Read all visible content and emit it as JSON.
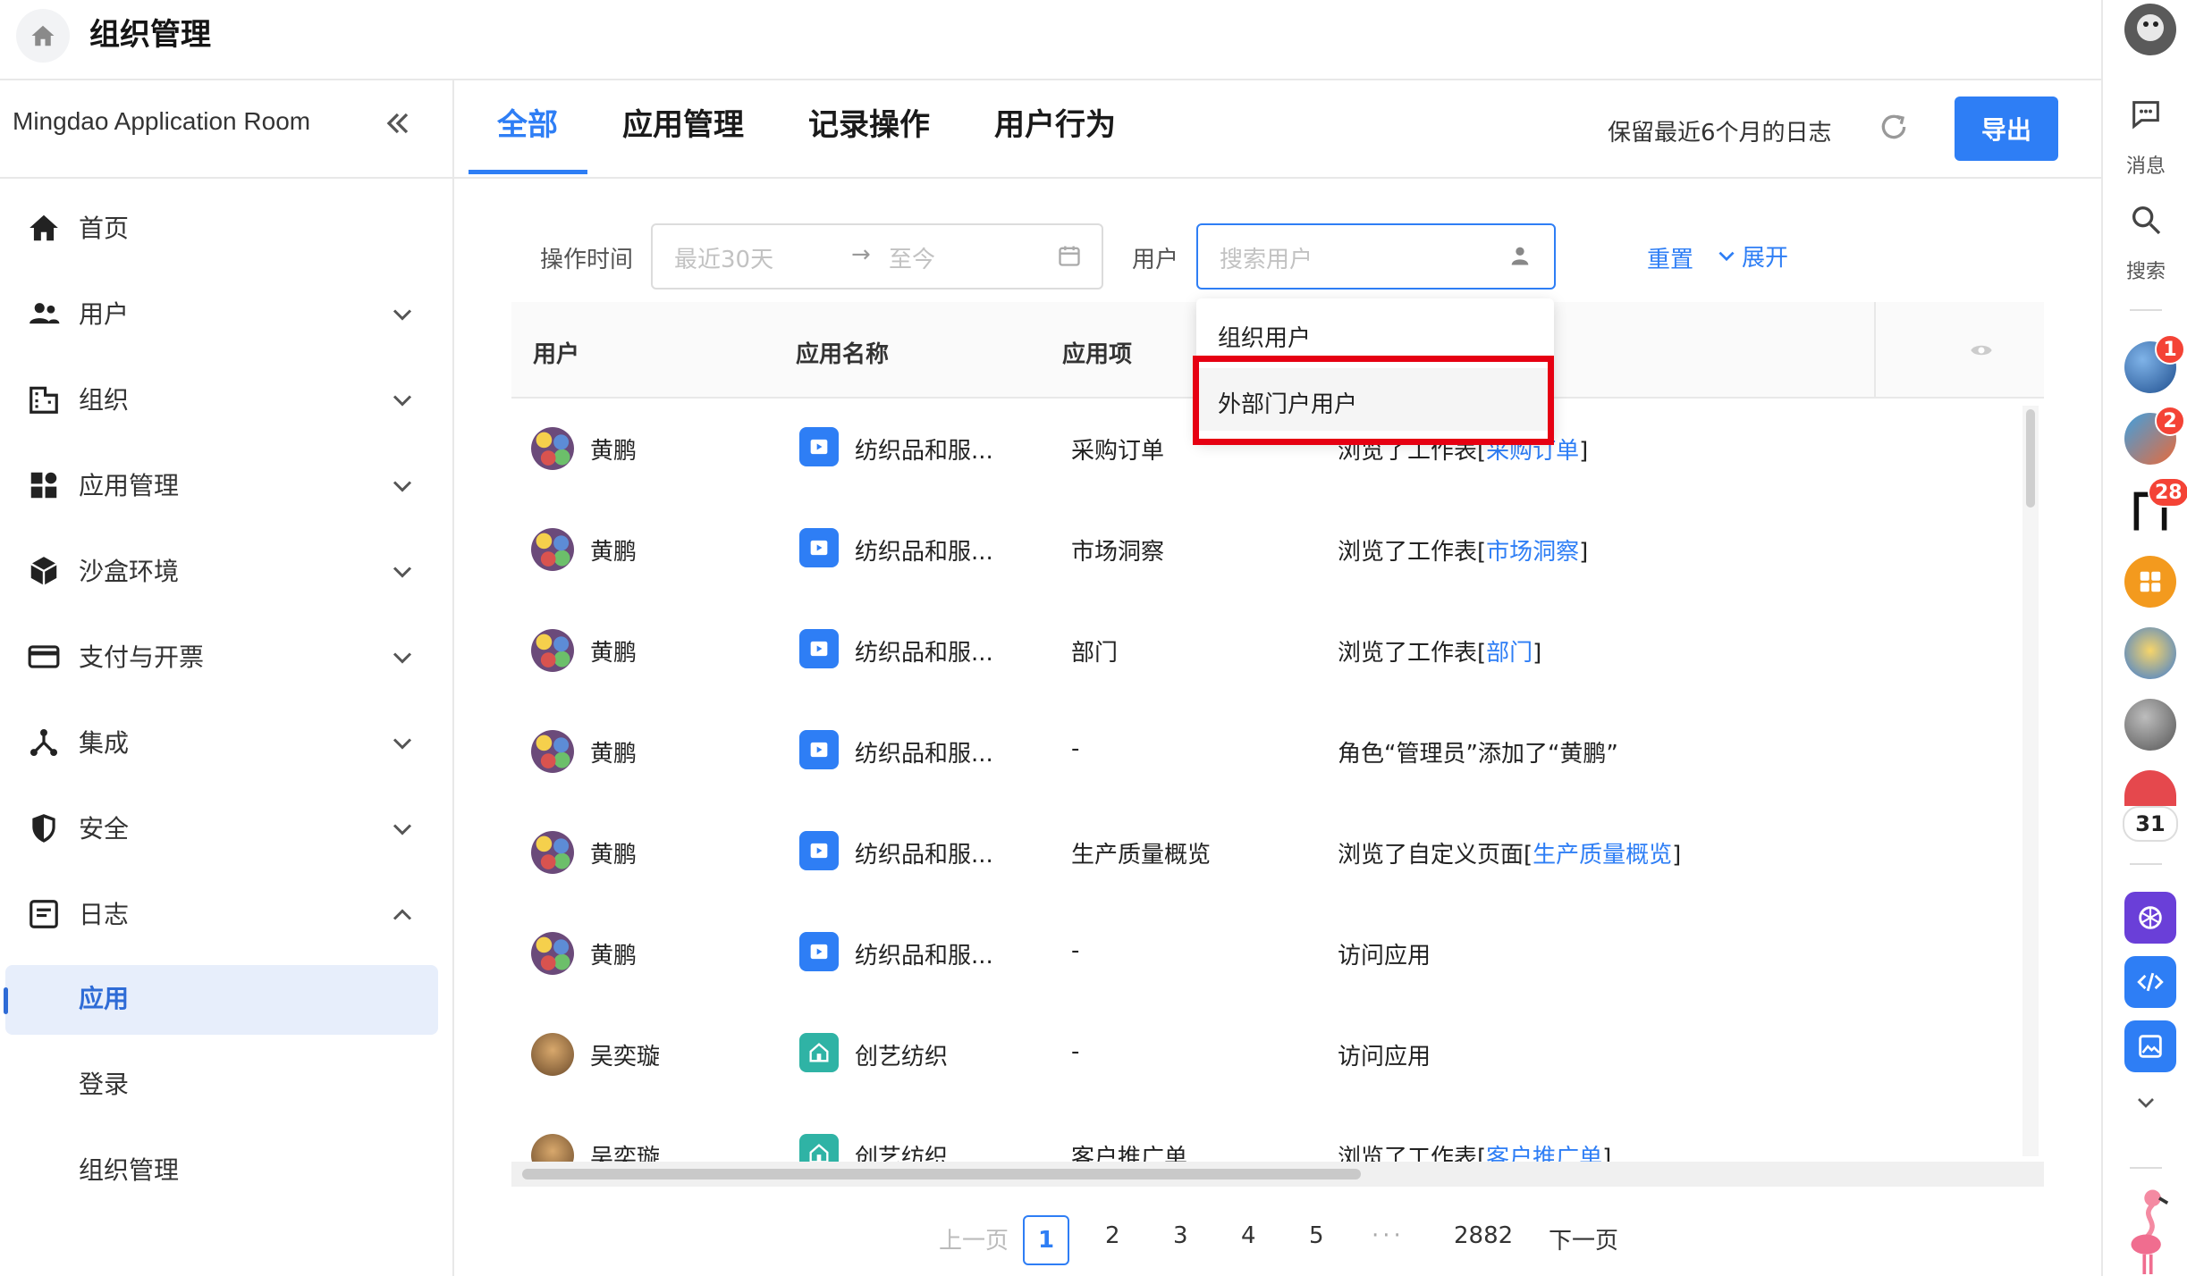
{
  "header": {
    "title": "组织管理"
  },
  "sidebar": {
    "workspace": "Mingdao Application Room",
    "items": [
      {
        "label": "首页"
      },
      {
        "label": "用户"
      },
      {
        "label": "组织"
      },
      {
        "label": "应用管理"
      },
      {
        "label": "沙盒环境"
      },
      {
        "label": "支付与开票"
      },
      {
        "label": "集成"
      },
      {
        "label": "安全"
      },
      {
        "label": "日志"
      }
    ],
    "log_subitems": [
      {
        "label": "应用"
      },
      {
        "label": "登录"
      },
      {
        "label": "组织管理"
      }
    ]
  },
  "tabs": [
    {
      "label": "全部"
    },
    {
      "label": "应用管理"
    },
    {
      "label": "记录操作"
    },
    {
      "label": "用户行为"
    }
  ],
  "toolbar": {
    "retention": "保留最近6个月的日志",
    "export_label": "导出"
  },
  "filters": {
    "time_label": "操作时间",
    "time_start_placeholder": "最近30天",
    "arrow": "→",
    "time_end_placeholder": "至今",
    "user_label": "用户",
    "user_placeholder": "搜索用户",
    "reset": "重置",
    "expand": "展开"
  },
  "dropdown": {
    "options": [
      {
        "label": "组织用户"
      },
      {
        "label": "外部门户用户"
      }
    ]
  },
  "table": {
    "columns": [
      "用户",
      "应用名称",
      "应用项"
    ],
    "rows": [
      {
        "user": "黄鹏",
        "app": "纺织品和服...",
        "item": "采购订单",
        "action_prefix": "浏览了工作表[",
        "action_link": "采购订单",
        "action_suffix": "]"
      },
      {
        "user": "黄鹏",
        "app": "纺织品和服...",
        "item": "市场洞察",
        "action_prefix": "浏览了工作表[",
        "action_link": "市场洞察",
        "action_suffix": "]"
      },
      {
        "user": "黄鹏",
        "app": "纺织品和服...",
        "item": "部门",
        "action_prefix": "浏览了工作表[",
        "action_link": "部门",
        "action_suffix": "]"
      },
      {
        "user": "黄鹏",
        "app": "纺织品和服...",
        "item": "-",
        "action_prefix": "角色“管理员”添加了“黄鹏”",
        "action_link": "",
        "action_suffix": ""
      },
      {
        "user": "黄鹏",
        "app": "纺织品和服...",
        "item": "生产质量概览",
        "action_prefix": "浏览了自定义页面[",
        "action_link": "生产质量概览",
        "action_suffix": "]"
      },
      {
        "user": "黄鹏",
        "app": "纺织品和服...",
        "item": "-",
        "action_prefix": "访问应用",
        "action_link": "",
        "action_suffix": ""
      },
      {
        "user": "吴奕璇",
        "app": "创艺纺织",
        "item": "-",
        "action_prefix": "访问应用",
        "action_link": "",
        "action_suffix": ""
      },
      {
        "user": "吴奕璇",
        "app": "创艺纺织",
        "item": "客户推广单",
        "action_prefix": "浏览了工作表[",
        "action_link": "客户推广单",
        "action_suffix": "]"
      }
    ]
  },
  "pagination": {
    "prev": "上一页",
    "pages": [
      "1",
      "2",
      "3",
      "4",
      "5"
    ],
    "ellipsis": "···",
    "last": "2882",
    "next": "下一页"
  },
  "rail": {
    "messages_label": "消息",
    "search_label": "搜索",
    "badges": [
      "1",
      "2",
      "28"
    ],
    "calendar_day": "31"
  },
  "colors": {
    "accent": "#2e7ef5",
    "highlight_box": "#e60012",
    "badge": "#f44336"
  }
}
